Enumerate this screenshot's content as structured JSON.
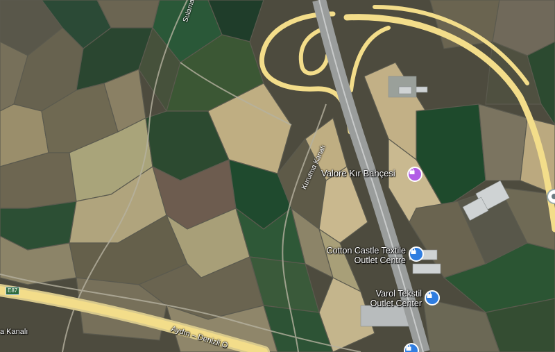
{
  "map": {
    "labels": {
      "sulama_kanali_top": "Sulama",
      "kurutma_kanali": "Kurutma Kanalı",
      "kanali_left": "a Kanalı",
      "aydin_denizli": "Aydın – Denizli O"
    },
    "highway_shield": "E87",
    "pois": [
      {
        "name": "Valore Kır Bahçesi",
        "icon": "shopping-bag-icon",
        "color": "#b25de6"
      },
      {
        "name_line1": "Cotton Castle Textile",
        "name_line2": "Outlet Centre",
        "icon": "shopping-bag-icon",
        "color": "#2f7de0"
      },
      {
        "name_line1": "Varol Tekstil",
        "name_line2": "Outlet Center",
        "icon": "shopping-bag-icon",
        "color": "#2f7de0"
      },
      {
        "name": "",
        "icon": "shopping-bag-icon",
        "color": "#2f7de0"
      }
    ],
    "colors": {
      "highway": "#f3dd8a",
      "field_dark": "#3f4a36",
      "field_green": "#1f4a2e",
      "field_tan": "#9b9070"
    }
  }
}
